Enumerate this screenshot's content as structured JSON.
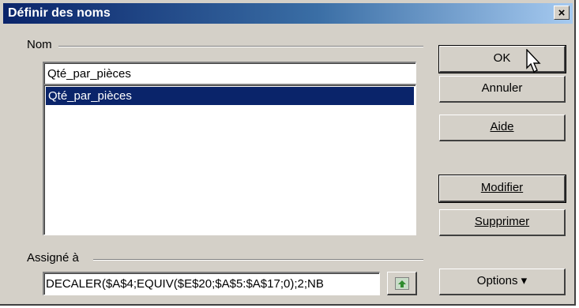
{
  "window": {
    "title": "Définir des noms",
    "close_label": "×"
  },
  "name_group": {
    "label": "Nom",
    "input_value": "Qté_par_pièces",
    "list_items": [
      "Qté_par_pièces"
    ]
  },
  "assign_group": {
    "label": "Assigné à",
    "value": "DECALER($A$4;EQUIV($E$20;$A$5:$A$17;0);2;NB"
  },
  "buttons": {
    "ok": "OK",
    "cancel": "Annuler",
    "help": "Aide",
    "modify": "Modifier",
    "delete": "Supprimer",
    "options": "Options",
    "options_arrow": "▾"
  },
  "colors": {
    "title_bar": "#0a246a",
    "selection": "#0a246a",
    "face": "#d4d0c8"
  }
}
